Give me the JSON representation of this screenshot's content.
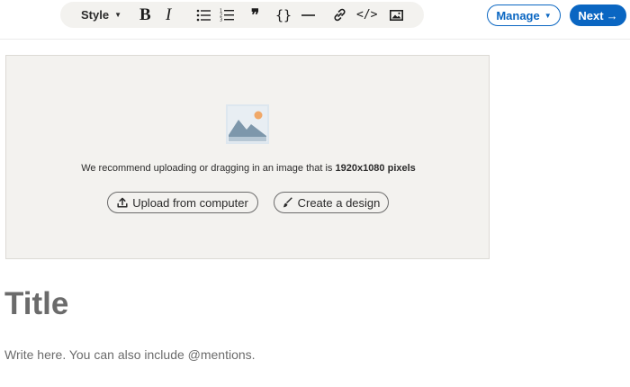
{
  "toolbar": {
    "style_label": "Style",
    "bold_label": "B",
    "italic_label": "I",
    "quote_label": "❞",
    "code_label": "{}",
    "embed_label": "</>",
    "icons": [
      "bulleted-list-icon",
      "numbered-list-icon",
      "horizontal-rule-icon",
      "link-icon",
      "image-icon"
    ]
  },
  "actions": {
    "manage_label": "Manage",
    "next_label": "Next"
  },
  "cover": {
    "recommend_text": "We recommend uploading or dragging in an image that is ",
    "recommend_size": "1920x1080 pixels",
    "upload_label": "Upload from computer",
    "design_label": "Create a design"
  },
  "editor": {
    "title_placeholder": "Title",
    "body_placeholder": "Write here. You can also include @mentions."
  },
  "colors": {
    "accent": "#0a66c2",
    "toolbar_bg": "#f3f2ef",
    "placeholder": "#6b6b6b"
  }
}
